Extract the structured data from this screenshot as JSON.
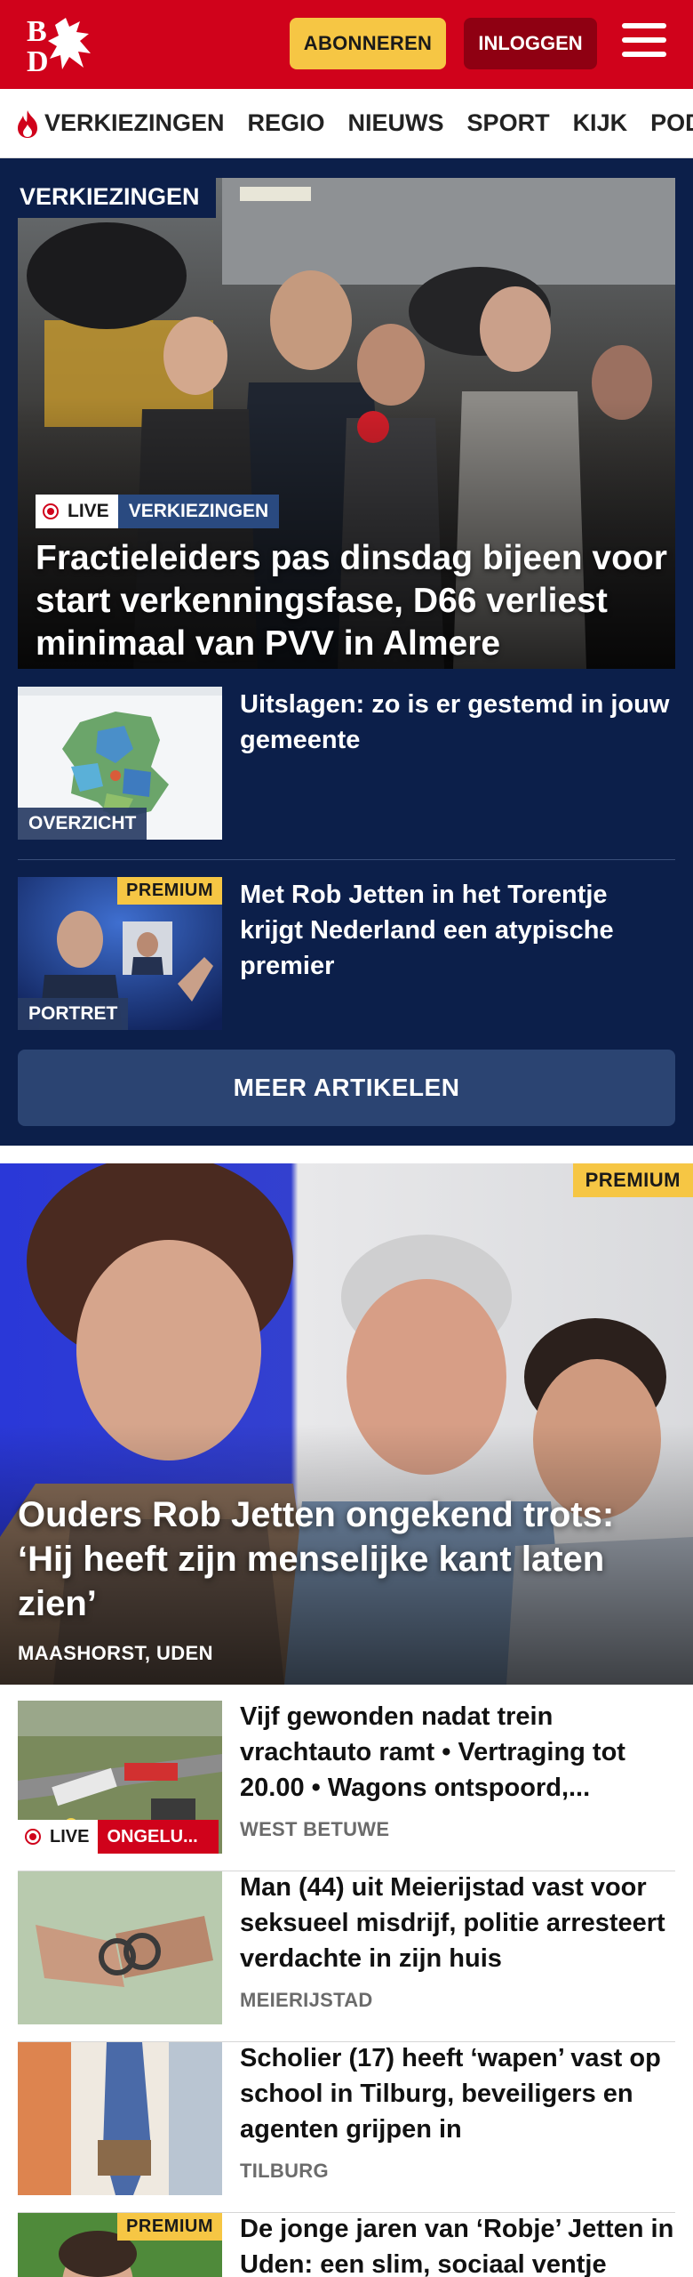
{
  "header": {
    "logo_text": "BD",
    "subscribe_label": "ABONNEREN",
    "login_label": "INLOGGEN"
  },
  "nav": {
    "items": [
      "VERKIEZINGEN",
      "REGIO",
      "NIEUWS",
      "SPORT",
      "KIJK",
      "PODC"
    ]
  },
  "election": {
    "section_label": "VERKIEZINGEN",
    "hero": {
      "live_label": "LIVE",
      "category": "VERKIEZINGEN",
      "title": "Fractieleiders pas dinsdag bijeen voor start verkenningsfase, D66 verliest minimaal van PVV in Almere"
    },
    "items": [
      {
        "label": "OVERZICHT",
        "title": "Uitslagen: zo is er gestemd in jouw gemeente"
      },
      {
        "label": "PORTRET",
        "premium": "PREMIUM",
        "title": "Met Rob Jetten in het Torentje krijgt Nederland een atypische premier"
      }
    ],
    "more_label": "MEER ARTIKELEN"
  },
  "feature": {
    "premium": "PREMIUM",
    "title": "Ouders Rob Jetten ongekend trots: ‘Hij heeft zijn menselijke kant laten zien’",
    "location": "MAASHORST, UDEN"
  },
  "list": [
    {
      "title": "Vijf gewonden nadat trein vrachtauto ramt • Vertraging tot 20.00 • Wagons ontspoord,...",
      "location": "WEST BETUWE",
      "live_label": "LIVE",
      "badge": "ONGELU..."
    },
    {
      "title": "Man (44) uit Meierijstad vast voor seksueel misdrijf, politie arresteert verdachte in zijn huis",
      "location": "MEIERIJSTAD"
    },
    {
      "title": "Scholier (17) heeft ‘wapen’ vast op school in Tilburg, beveiligers en agenten grijpen in",
      "location": "TILBURG"
    },
    {
      "title": "De jonge jaren van ‘Robje’ Jetten in Uden: een slim, sociaal ventje",
      "premium": "PREMIUM"
    }
  ],
  "colors": {
    "brand_red": "#d0021b",
    "premium_yellow": "#f6c644",
    "election_navy": "#0c1f4a"
  }
}
